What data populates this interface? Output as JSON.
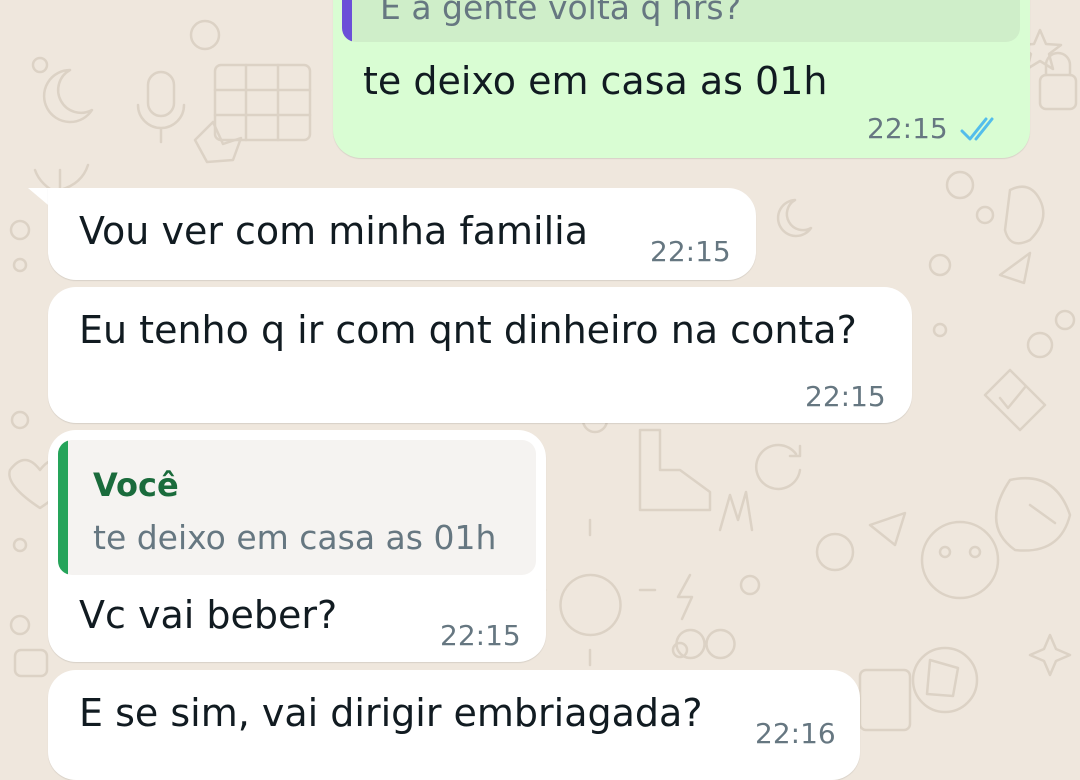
{
  "theme": {
    "wallpaper": "#efe7dd",
    "outgoing_bubble": "#d9fdd3",
    "incoming_bubble": "#ffffff",
    "outgoing_quote_bg": "#cfeec9",
    "incoming_quote_bg": "#f5f3f1",
    "outgoing_quote_bar": "#6b4fd8",
    "incoming_quote_bar": "#25a45a",
    "quote_author_color": "#1a6b3c",
    "read_ticks_color": "#53bdeb",
    "timestamp_color": "#667781"
  },
  "messages": [
    {
      "direction": "outgoing",
      "quote_text": "E a gente volta q hrs?",
      "text": "te deixo em casa as 01h",
      "time": "22:15",
      "status_icon": "double-check-read-icon"
    },
    {
      "direction": "incoming",
      "text": "Vou ver com minha familia",
      "time": "22:15"
    },
    {
      "direction": "incoming",
      "text": "Eu tenho q ir com qnt dinheiro na conta?",
      "time": "22:15"
    },
    {
      "direction": "incoming",
      "quote_author": "Você",
      "quote_text": "te deixo em casa as 01h",
      "text": "Vc vai beber?",
      "time": "22:15"
    },
    {
      "direction": "incoming",
      "text": "E se sim, vai dirigir embriagada?",
      "time": "22:16"
    }
  ]
}
